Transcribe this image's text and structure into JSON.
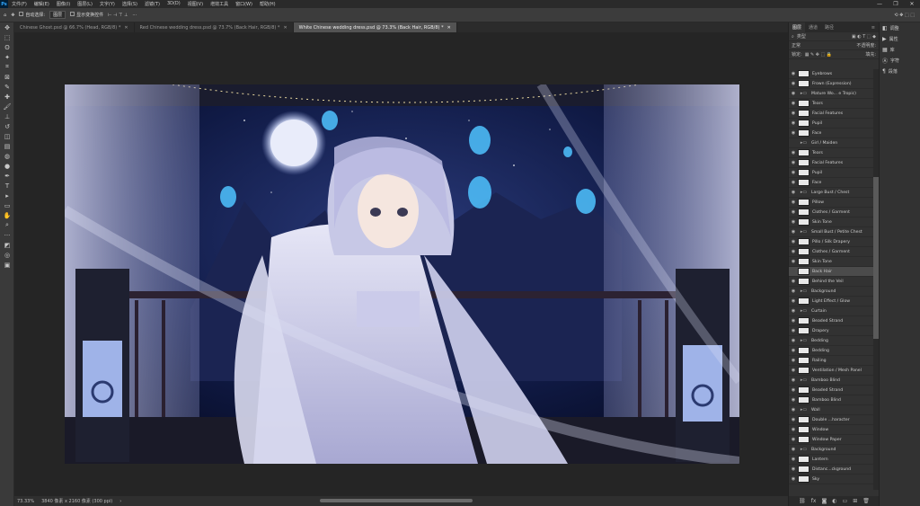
{
  "menubar": {
    "logo": "Ps",
    "items": [
      "文件(F)",
      "编辑(E)",
      "图像(I)",
      "图层(L)",
      "文字(Y)",
      "选择(S)",
      "滤镜(T)",
      "3D(D)",
      "视图(V)",
      "增效工具",
      "窗口(W)",
      "帮助(H)"
    ],
    "win": [
      "—",
      "❐",
      "✕"
    ]
  },
  "options": {
    "auto_select": "自动选择:",
    "layer_mode": "图层",
    "transform": "显示变换控件",
    "more": "···"
  },
  "tabs": [
    {
      "label": "Chinese Ghost.psd @ 66.7% (Head, RGB/8) *"
    },
    {
      "label": "Red Chinese wedding dress.psd @ 73.7% (Back Hair, RGB/8) *"
    },
    {
      "label": "White Chinese wedding dress.psd @ 73.3% (Back Hair, RGB/8) *"
    }
  ],
  "status": {
    "zoom": "73.33%",
    "doc": "3840 像素 x 2160 像素 (300 ppi)"
  },
  "panel": {
    "tabs": [
      "图层",
      "通道",
      "路径"
    ],
    "kind": "类型",
    "mode": "正常",
    "opacity": "不透明度:",
    "lock": "锁定:",
    "fill": "填充:",
    "layers": [
      {
        "name": "Eyebrows",
        "kind": "layer",
        "eye": true
      },
      {
        "name": "Frown (Expression)",
        "kind": "layer",
        "eye": true
      },
      {
        "name": "Mature Wo... e Tropic)",
        "kind": "group",
        "eye": true
      },
      {
        "name": "Tears",
        "kind": "layer",
        "eye": true
      },
      {
        "name": "Facial Features",
        "kind": "layer",
        "eye": true
      },
      {
        "name": "Pupil",
        "kind": "layer",
        "eye": true
      },
      {
        "name": "Face",
        "kind": "layer",
        "eye": true
      },
      {
        "name": "Girl / Maiden",
        "kind": "group",
        "eye": false
      },
      {
        "name": "Tears",
        "kind": "layer",
        "eye": true
      },
      {
        "name": "Facial Features",
        "kind": "layer",
        "eye": true
      },
      {
        "name": "Pupil",
        "kind": "layer",
        "eye": true
      },
      {
        "name": "Face",
        "kind": "layer",
        "eye": true
      },
      {
        "name": "Large Bust / Chest",
        "kind": "group",
        "eye": true
      },
      {
        "name": "Pillow",
        "kind": "layer",
        "eye": true
      },
      {
        "name": "Clothes / Garment",
        "kind": "layer",
        "eye": true
      },
      {
        "name": "Skin Tone",
        "kind": "layer",
        "eye": true
      },
      {
        "name": "Small Bust / Petite Chest",
        "kind": "group",
        "eye": true
      },
      {
        "name": "Pillo / Silk Drapery",
        "kind": "layer",
        "eye": true
      },
      {
        "name": "Clothes / Garment",
        "kind": "layer",
        "eye": true
      },
      {
        "name": "Skin Tone",
        "kind": "layer",
        "eye": true
      },
      {
        "name": "Back Hair",
        "kind": "layer",
        "eye": false,
        "sel": true
      },
      {
        "name": "Behind the Veil",
        "kind": "layer",
        "eye": true
      },
      {
        "name": "Background",
        "kind": "group",
        "eye": true
      },
      {
        "name": "Light Effect / Glow",
        "kind": "layer",
        "eye": true
      },
      {
        "name": "Curtain",
        "kind": "group",
        "eye": true
      },
      {
        "name": "Beaded Strand",
        "kind": "layer",
        "eye": true
      },
      {
        "name": "Drapery",
        "kind": "layer",
        "eye": true
      },
      {
        "name": "Bedding",
        "kind": "group",
        "eye": true
      },
      {
        "name": "Bedding",
        "kind": "layer",
        "eye": true
      },
      {
        "name": "Railing",
        "kind": "layer",
        "eye": true
      },
      {
        "name": "Ventilation / Mesh Panel",
        "kind": "layer",
        "eye": true
      },
      {
        "name": "Bamboo Blind",
        "kind": "group",
        "eye": true
      },
      {
        "name": "Beaded Strand",
        "kind": "layer",
        "eye": true
      },
      {
        "name": "Bamboo Blind",
        "kind": "layer",
        "eye": true
      },
      {
        "name": "Wall",
        "kind": "group",
        "eye": true
      },
      {
        "name": "Double ...haracter",
        "kind": "layer",
        "eye": true
      },
      {
        "name": "Window",
        "kind": "layer",
        "eye": true
      },
      {
        "name": "Window Paper",
        "kind": "layer",
        "eye": true
      },
      {
        "name": "Background",
        "kind": "group",
        "eye": true
      },
      {
        "name": "Lantern",
        "kind": "layer",
        "eye": true
      },
      {
        "name": "Distanc...ckground",
        "kind": "layer",
        "eye": true
      },
      {
        "name": "Sky",
        "kind": "layer",
        "eye": true
      }
    ]
  },
  "right_panel": {
    "items": [
      {
        "icon": "◧",
        "label": "调整"
      },
      {
        "icon": "▶",
        "label": "属性"
      },
      {
        "icon": "▦",
        "label": "库"
      },
      {
        "icon": "Ⓐ",
        "label": "字符"
      },
      {
        "icon": "¶",
        "label": "段落"
      }
    ]
  },
  "colors": {
    "accent": "#31a8ff",
    "bg": "#535353"
  }
}
